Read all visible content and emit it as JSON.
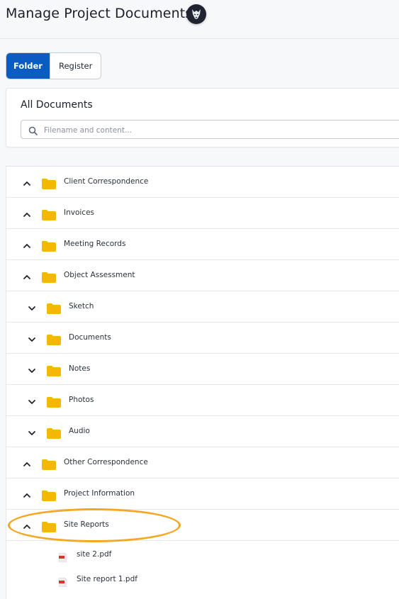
{
  "header": {
    "title": "Manage Project Documents",
    "logo_icon": "wolf-logo-icon"
  },
  "tabs": [
    {
      "label": "Folder",
      "active": true
    },
    {
      "label": "Register",
      "active": false
    }
  ],
  "documents": {
    "title": "All Documents",
    "search_placeholder": "Filename and content...",
    "search_value": ""
  },
  "tree": {
    "folders": [
      {
        "label": "Client Correspondence",
        "level": 0,
        "state": "expanded"
      },
      {
        "label": "Invoices",
        "level": 0,
        "state": "expanded"
      },
      {
        "label": "Meeting Records",
        "level": 0,
        "state": "expanded"
      },
      {
        "label": "Object Assessment",
        "level": 0,
        "state": "expanded"
      },
      {
        "label": "Sketch",
        "level": 1,
        "state": "collapsed"
      },
      {
        "label": "Documents",
        "level": 1,
        "state": "collapsed"
      },
      {
        "label": "Notes",
        "level": 1,
        "state": "collapsed"
      },
      {
        "label": "Photos",
        "level": 1,
        "state": "collapsed"
      },
      {
        "label": "Audio",
        "level": 1,
        "state": "collapsed"
      },
      {
        "label": "Other Correspondence",
        "level": 0,
        "state": "expanded"
      },
      {
        "label": "Project Information",
        "level": 0,
        "state": "expanded"
      },
      {
        "label": "Site Reports",
        "level": 0,
        "state": "expanded",
        "highlighted": true
      }
    ],
    "files": [
      {
        "label": "site 2.pdf",
        "icon": "pdf-file-icon"
      },
      {
        "label": "Site report 1.pdf",
        "icon": "pdf-file-icon"
      }
    ]
  },
  "colors": {
    "accent": "#0a5cc2",
    "folder": "#f5b800",
    "highlight": "#f5a623",
    "pdf": "#d9342b"
  }
}
